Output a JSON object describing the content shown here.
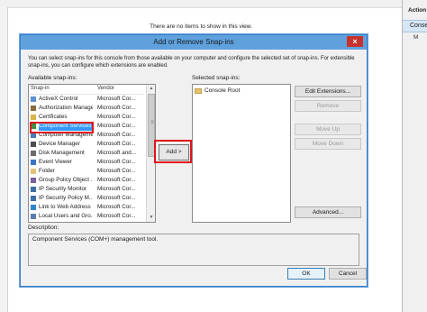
{
  "background": {
    "empty_message": "There are no items to show in this view.",
    "actions_header": "Action",
    "actions_item": "Conse",
    "actions_sub": "M"
  },
  "dialog": {
    "title": "Add or Remove Snap-ins",
    "close_label": "×",
    "description": "You can select snap-ins for this console from those available on your computer and configure the selected set of snap-ins. For extensible snap-ins, you can configure which extensions are enabled.",
    "available_label": "Available snap-ins:",
    "columns": {
      "snapin": "Snap-in",
      "vendor": "Vendor"
    },
    "snapins": [
      {
        "name": "ActiveX Control",
        "vendor": "Microsoft Cor...",
        "icon": "activex-icon",
        "color": "#5c8fd6"
      },
      {
        "name": "Authorization Manager",
        "vendor": "Microsoft Cor...",
        "icon": "authorization-icon",
        "color": "#8a6b3d"
      },
      {
        "name": "Certificates",
        "vendor": "Microsoft Cor...",
        "icon": "certificate-icon",
        "color": "#d9b44a"
      },
      {
        "name": "Component Services",
        "vendor": "Microsoft Cor...",
        "icon": "component-services-icon",
        "color": "#3f8f3f",
        "selected": true
      },
      {
        "name": "Computer Management",
        "vendor": "Microsoft Cor...",
        "icon": "computer-icon",
        "color": "#4a7ab8"
      },
      {
        "name": "Device Manager",
        "vendor": "Microsoft Cor...",
        "icon": "device-manager-icon",
        "color": "#4d4d4d"
      },
      {
        "name": "Disk Management",
        "vendor": "Microsoft and...",
        "icon": "disk-icon",
        "color": "#6b6b6b"
      },
      {
        "name": "Event Viewer",
        "vendor": "Microsoft Cor...",
        "icon": "event-viewer-icon",
        "color": "#3a74c4"
      },
      {
        "name": "Folder",
        "vendor": "Microsoft Cor...",
        "icon": "folder-icon",
        "color": "#e4c374"
      },
      {
        "name": "Group Policy Object ...",
        "vendor": "Microsoft Cor...",
        "icon": "group-policy-icon",
        "color": "#7a5fa0"
      },
      {
        "name": "IP Security Monitor",
        "vendor": "Microsoft Cor...",
        "icon": "ip-security-icon",
        "color": "#3f6fa8"
      },
      {
        "name": "IP Security Policy M...",
        "vendor": "Microsoft Cor...",
        "icon": "ip-policy-icon",
        "color": "#3f6fa8"
      },
      {
        "name": "Link to Web Address",
        "vendor": "Microsoft Cor...",
        "icon": "web-link-icon",
        "color": "#2d86d0"
      },
      {
        "name": "Local Users and Gro...",
        "vendor": "Microsoft Cor...",
        "icon": "users-icon",
        "color": "#5a7fb0"
      }
    ],
    "add_label": "Add >",
    "selected_label": "Selected snap-ins:",
    "selected_root": "Console Root",
    "buttons": {
      "edit_extensions": "Edit Extensions...",
      "remove": "Remove",
      "move_up": "Move Up",
      "move_down": "Move Down",
      "advanced": "Advanced..."
    },
    "description_label": "Description:",
    "description_text": "Component Services (COM+) management tool.",
    "ok": "OK",
    "cancel": "Cancel"
  },
  "colors": {
    "titlebar": "#5ea1dd",
    "selection": "#3399ff",
    "highlight": "#e0141c",
    "close": "#c7332c"
  }
}
